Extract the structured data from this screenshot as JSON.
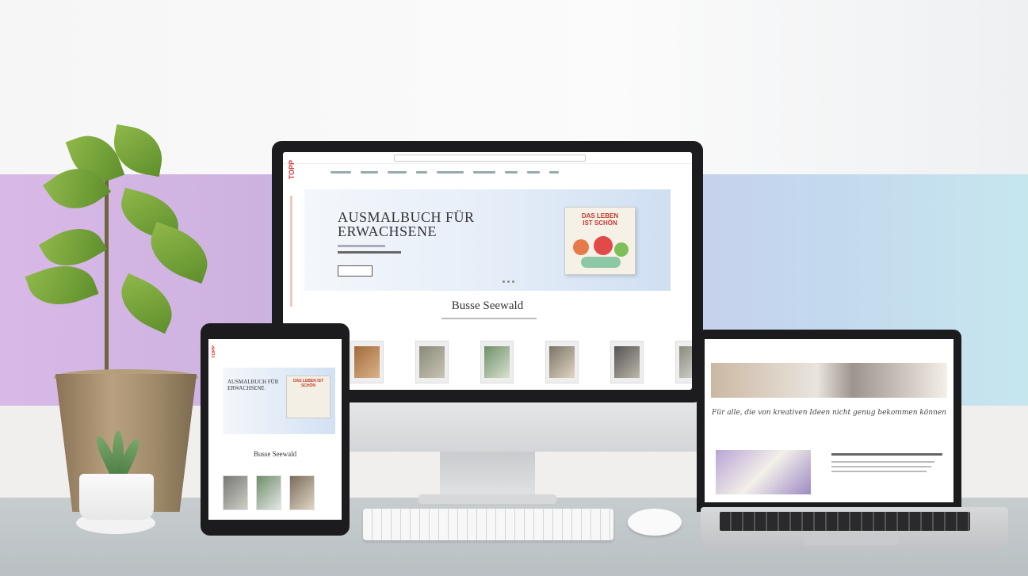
{
  "monitor": {
    "logo": "TOPP",
    "hero_headline": "AUSMALBUCH FÜR ERWACHSENE",
    "hero_book_title": "DAS LEBEN IST SCHÖN",
    "brand_title": "Busse Seewald"
  },
  "tablet": {
    "logo": "TOPP",
    "hero_headline": "AUSMALBUCH FÜR ERWACHSENE",
    "hero_book_title": "DAS LEBEN IST SCHÖN",
    "brand_title": "Busse Seewald"
  },
  "laptop": {
    "script_line": "Für alle, die von kreativen Ideen nicht genug bekommen können"
  },
  "colors": {
    "brand_red": "#d6312d",
    "stripe_left": "#d9b8e6",
    "stripe_right": "#c6e6ee"
  }
}
